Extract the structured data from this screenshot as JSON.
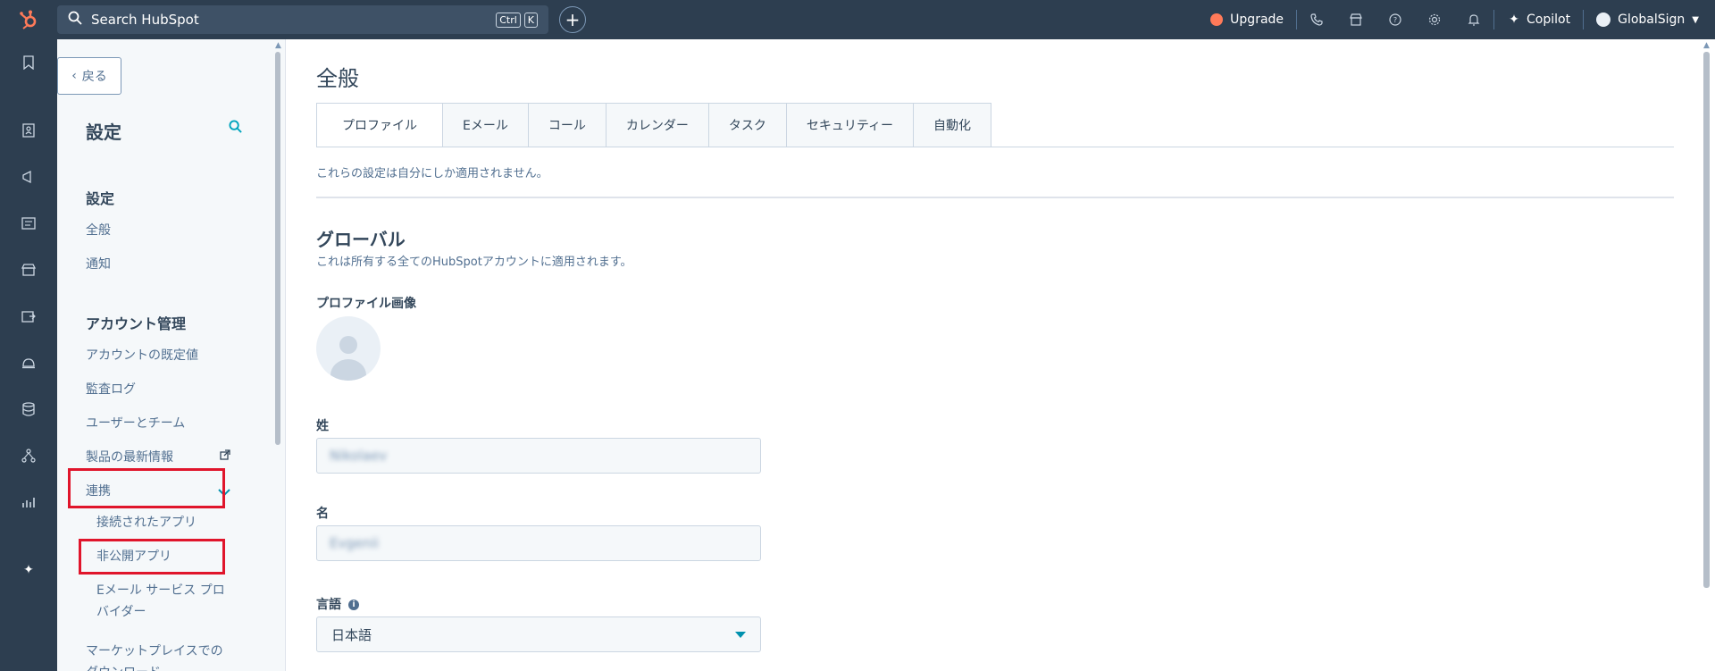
{
  "topbar": {
    "search_placeholder": "Search HubSpot",
    "kbd_ctrl": "Ctrl",
    "kbd_k": "K",
    "upgrade": "Upgrade",
    "copilot": "Copilot",
    "account": "GlobalSign"
  },
  "sidebar": {
    "back": "戻る",
    "title": "設定",
    "sections": {
      "settings_heading": "設定",
      "general": "全般",
      "notifications": "通知",
      "account_heading": "アカウント管理",
      "account_defaults": "アカウントの既定値",
      "audit_log": "監査ログ",
      "users_teams": "ユーザーとチーム",
      "product_updates": "製品の最新情報",
      "integrations": "連携",
      "connected_apps": "接続されたアプリ",
      "private_apps": "非公開アプリ",
      "email_provider_line1": "Eメール サービス プロ",
      "email_provider_line2": "バイダー",
      "marketplace_line1": "マーケットプレイスでの",
      "marketplace_line2": "ダウンロード"
    }
  },
  "main": {
    "title": "全般",
    "tabs": [
      "プロファイル",
      "Eメール",
      "コール",
      "カレンダー",
      "タスク",
      "セキュリティー",
      "自動化"
    ],
    "note": "これらの設定は自分にしか適用されません。",
    "global_heading": "グローバル",
    "global_desc": "これは所有する全てのHubSpotアカウントに適用されます。",
    "profile_image_label": "プロファイル画像",
    "last_name_label": "姓",
    "last_name_value": "Nikolaev",
    "first_name_label": "名",
    "first_name_value": "Evgenii",
    "language_label": "言語",
    "language_value": "日本語"
  },
  "colors": {
    "nav": "#2d3e50",
    "accent": "#0091ae",
    "highlight": "#e0152b",
    "upgrade": "#ff7a59"
  }
}
